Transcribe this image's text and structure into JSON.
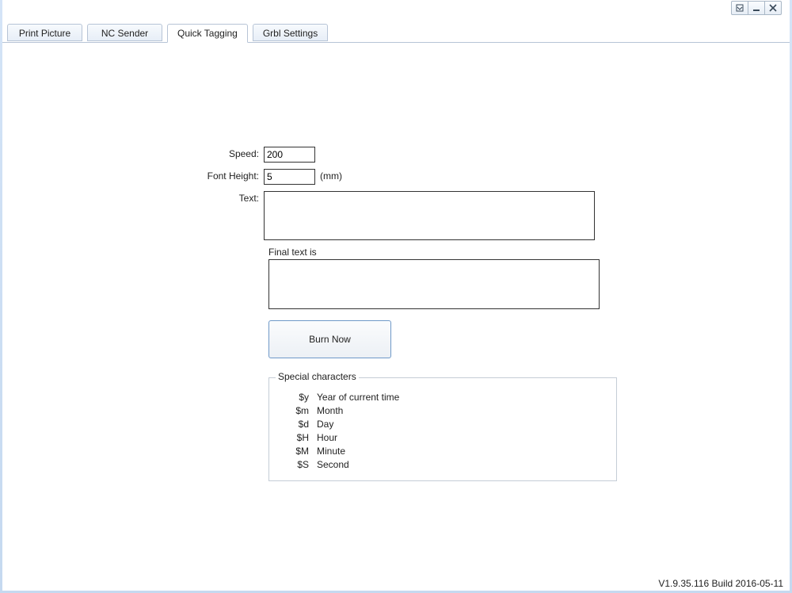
{
  "tabs": [
    {
      "label": "Print Picture",
      "active": false
    },
    {
      "label": "NC Sender",
      "active": false
    },
    {
      "label": "Quick Tagging",
      "active": true
    },
    {
      "label": "Grbl Settings",
      "active": false
    }
  ],
  "form": {
    "speed_label": "Speed:",
    "speed_value": "200",
    "font_height_label": "Font Height:",
    "font_height_value": "5",
    "font_height_suffix": "(mm)",
    "text_label": "Text:",
    "text_value": "",
    "final_label": "Final text is",
    "final_value": "",
    "burn_label": "Burn Now"
  },
  "special": {
    "legend": "Special characters",
    "rows": [
      {
        "code": "$y",
        "desc": "Year of current time"
      },
      {
        "code": "$m",
        "desc": "Month"
      },
      {
        "code": "$d",
        "desc": "Day"
      },
      {
        "code": "$H",
        "desc": "Hour"
      },
      {
        "code": "$M",
        "desc": "Minute"
      },
      {
        "code": "$S",
        "desc": "Second"
      }
    ]
  },
  "version": "V1.9.35.116 Build 2016-05-11"
}
